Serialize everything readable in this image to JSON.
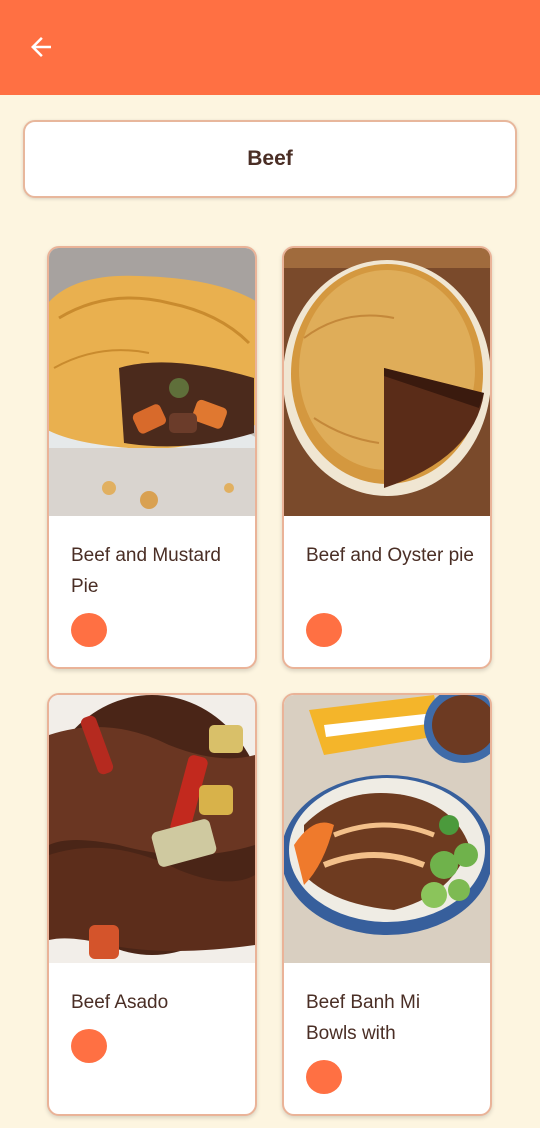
{
  "app_bar": {
    "back_icon": "arrow-left-icon",
    "color": "#ff7043"
  },
  "category": {
    "title": "Beef"
  },
  "meals": [
    {
      "name": "Beef and Mustard Pie",
      "image": "beef-and-mustard-pie-photo"
    },
    {
      "name": "Beef and Oyster pie",
      "image": "beef-and-oyster-pie-photo"
    },
    {
      "name": "Beef Asado",
      "image": "beef-asado-photo"
    },
    {
      "name": "Beef Banh Mi Bowls with",
      "image": "beef-banh-mi-bowls-photo"
    }
  ],
  "colors": {
    "accent": "#ff7043",
    "background": "#fdf5e0",
    "text": "#4a2e25"
  }
}
